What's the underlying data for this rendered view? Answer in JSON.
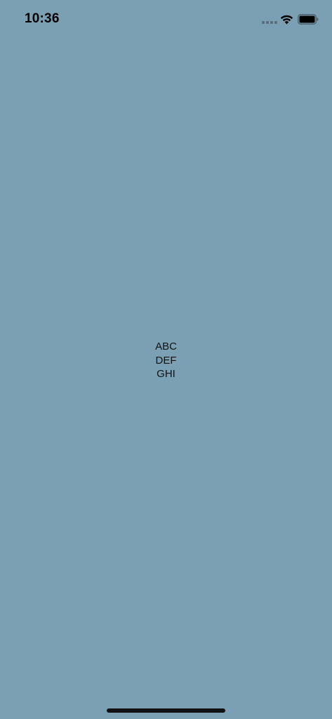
{
  "status_bar": {
    "time": "10:36",
    "icons": [
      "signal-icon",
      "wifi-icon",
      "battery-icon"
    ]
  },
  "content": {
    "lines": [
      "ABC",
      "DEF",
      "GHI"
    ]
  },
  "colors": {
    "background": "#7ba0b4",
    "text": "#111111"
  }
}
